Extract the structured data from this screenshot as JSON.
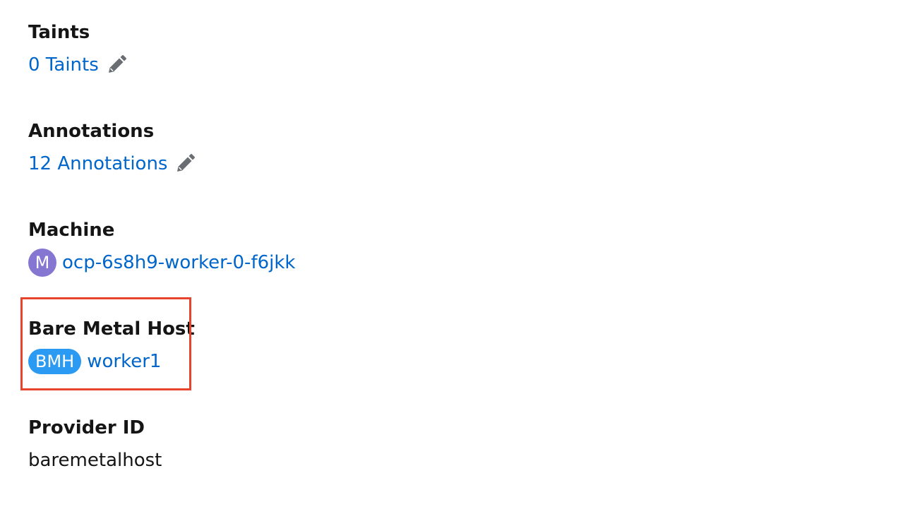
{
  "taints": {
    "label": "Taints",
    "value": "0 Taints",
    "edit_icon": "pencil-icon"
  },
  "annotations": {
    "label": "Annotations",
    "value": "12 Annotations",
    "edit_icon": "pencil-icon"
  },
  "machine": {
    "label": "Machine",
    "badge": "M",
    "badge_color": "#8476d1",
    "name": "ocp-6s8h9-worker-0-f6jkk"
  },
  "bare_metal_host": {
    "label": "Bare Metal Host",
    "badge": "BMH",
    "badge_color": "#2b9af3",
    "name": "worker1",
    "highlight_color": "#e8442d"
  },
  "provider_id": {
    "label": "Provider ID",
    "value": "baremetalhost"
  },
  "colors": {
    "link": "#0066cc",
    "text": "#151515"
  }
}
